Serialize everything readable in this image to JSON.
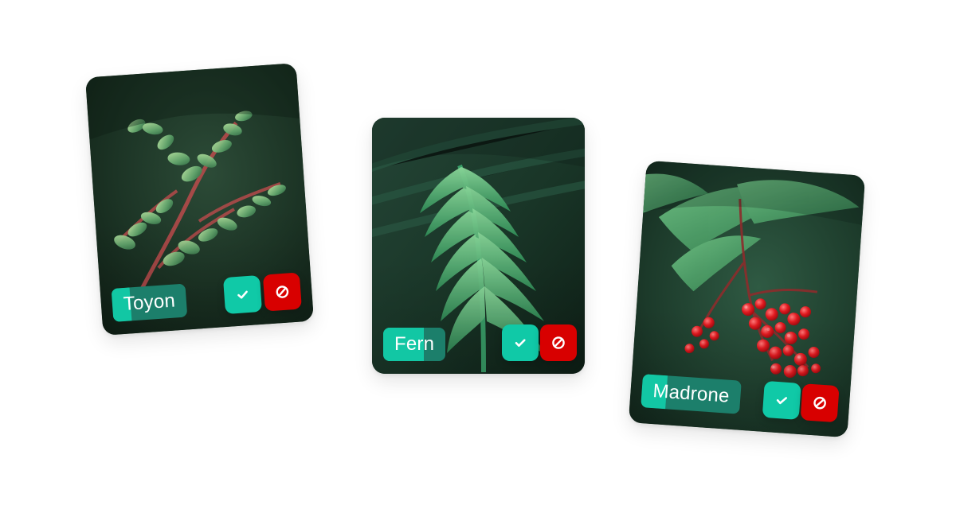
{
  "cards": [
    {
      "label": "Toyon",
      "label_fill_percent": 25,
      "actions": [
        "confirm",
        "reject"
      ]
    },
    {
      "label": "Fern",
      "label_fill_percent": 65,
      "actions": [
        "confirm",
        "reject"
      ]
    },
    {
      "label": "Madrone",
      "label_fill_percent": 25,
      "actions": [
        "confirm",
        "reject"
      ]
    }
  ],
  "colors": {
    "confirm": "#10c9a7",
    "reject": "#d80000",
    "label_base": "#1c7f6b",
    "label_fill": "#12c7a4"
  },
  "icons": {
    "confirm": "check-icon",
    "reject": "no-entry-icon"
  }
}
